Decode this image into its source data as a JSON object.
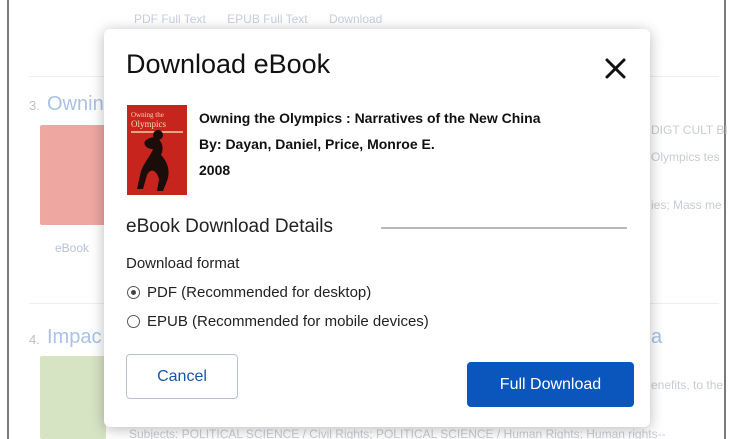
{
  "background": {
    "top_links": [
      "PDF Full Text",
      "EPUB Full Text",
      "Download"
    ],
    "item3": {
      "number": "3.",
      "title": "Ownin",
      "side_text_1": "DIGT CULT BI",
      "side_text_2": "Olympics tes",
      "side_text_3": "ies; Mass me",
      "thumb_label": "eBook"
    },
    "item4": {
      "number": "4.",
      "title": "Impac",
      "title_tail": "a",
      "side_text_1": "enefits, to the",
      "subjects": "Subjects: POLITICAL SCIENCE / Civil Rights; POLITICAL SCIENCE / Human Rights; Human rights--"
    }
  },
  "modal": {
    "title": "Download eBook",
    "close_icon": "close-icon",
    "book": {
      "title_line": "Owning the Olympics : Narratives of the New China",
      "authors_line": "By: Dayan, Daniel, Price, Monroe E.",
      "year": "2008",
      "cover_title": "Owning the Olympics",
      "cover_color": "#c8241e"
    },
    "section_title": "eBook Download Details",
    "format_label": "Download format",
    "formats": [
      {
        "label": "PDF (Recommended for desktop)",
        "checked": true
      },
      {
        "label": "EPUB (Recommended for mobile devices)",
        "checked": false
      }
    ],
    "cancel_label": "Cancel",
    "download_label": "Full Download",
    "accent_color": "#0b56bd"
  }
}
